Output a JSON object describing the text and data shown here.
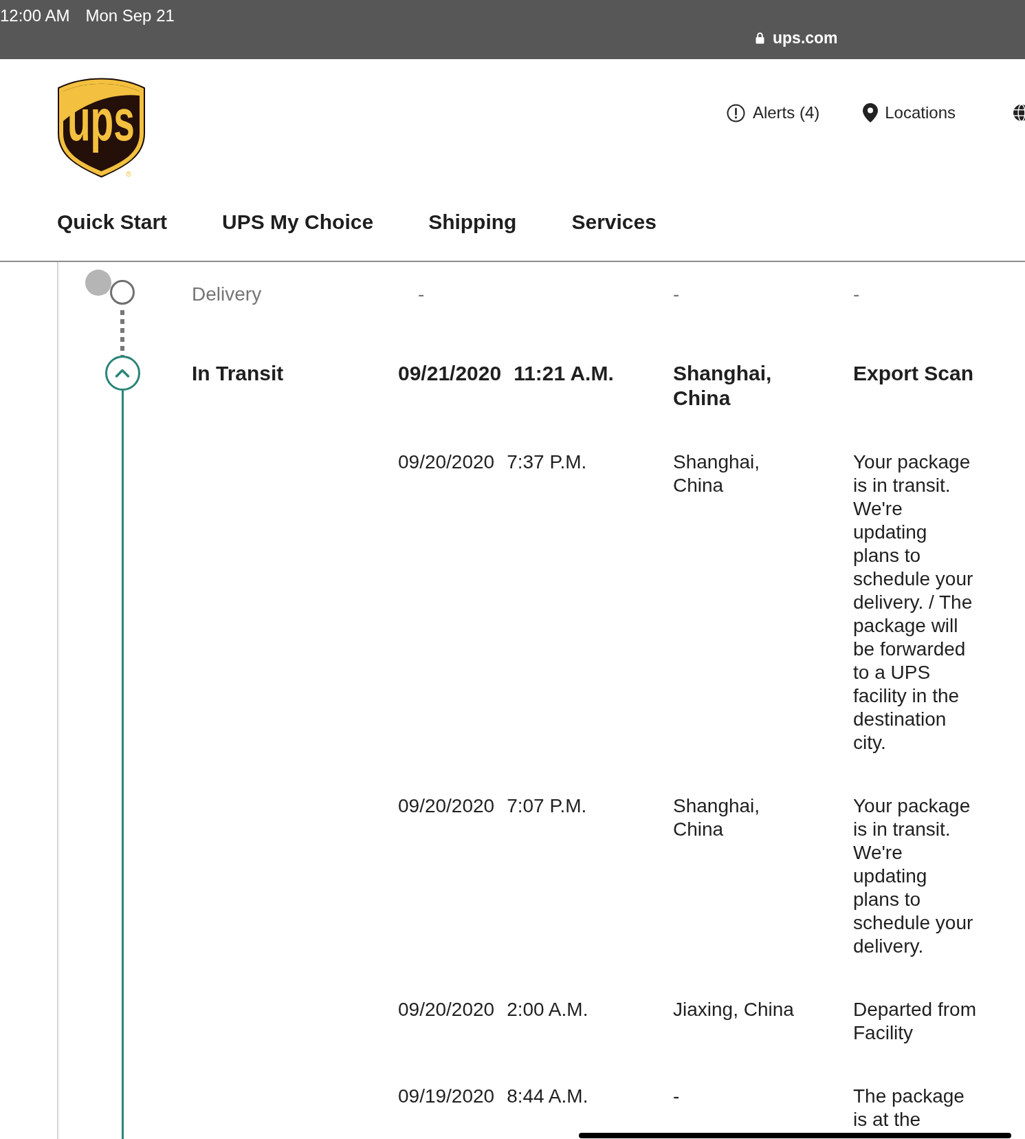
{
  "status_bar": {
    "time": "12:00 AM",
    "date": "Mon Sep 21"
  },
  "address_bar": {
    "url": "ups.com"
  },
  "header": {
    "logo": {
      "text": "ups",
      "mark": "®"
    },
    "utility_links": [
      {
        "kind": "alerts",
        "label": "Alerts (4)"
      },
      {
        "kind": "locations",
        "label": "Locations"
      },
      {
        "kind": "language"
      }
    ]
  },
  "nav": [
    "Quick Start",
    "UPS My Choice",
    "Shipping",
    "Services"
  ],
  "timeline": [
    {
      "kind": "pending",
      "label": "Delivery",
      "events": [
        {
          "date": "-",
          "location": "-",
          "description": "-"
        }
      ]
    },
    {
      "kind": "current",
      "label": "In Transit",
      "expanded": true,
      "events": [
        {
          "date": "09/21/2020",
          "time": "11:21 A.M.",
          "location": "Shanghai, China",
          "description": "Export Scan"
        },
        {
          "date": "09/20/2020",
          "time": "7:37 P.M.",
          "location": "Shanghai, China",
          "description": "Your package is in transit. We're updating plans to schedule your delivery. / The package will be forwarded to a UPS facility in the destination city."
        },
        {
          "date": "09/20/2020",
          "time": "7:07 P.M.",
          "location": "Shanghai, China",
          "description": "Your package is in transit. We're updating plans to schedule your delivery."
        },
        {
          "date": "09/20/2020",
          "time": "2:00 A.M.",
          "location": "Jiaxing, China",
          "description": "Departed from Facility"
        },
        {
          "date": "09/19/2020",
          "time": "8:44 A.M.",
          "location": "-",
          "description": "The package is at the"
        }
      ]
    }
  ]
}
